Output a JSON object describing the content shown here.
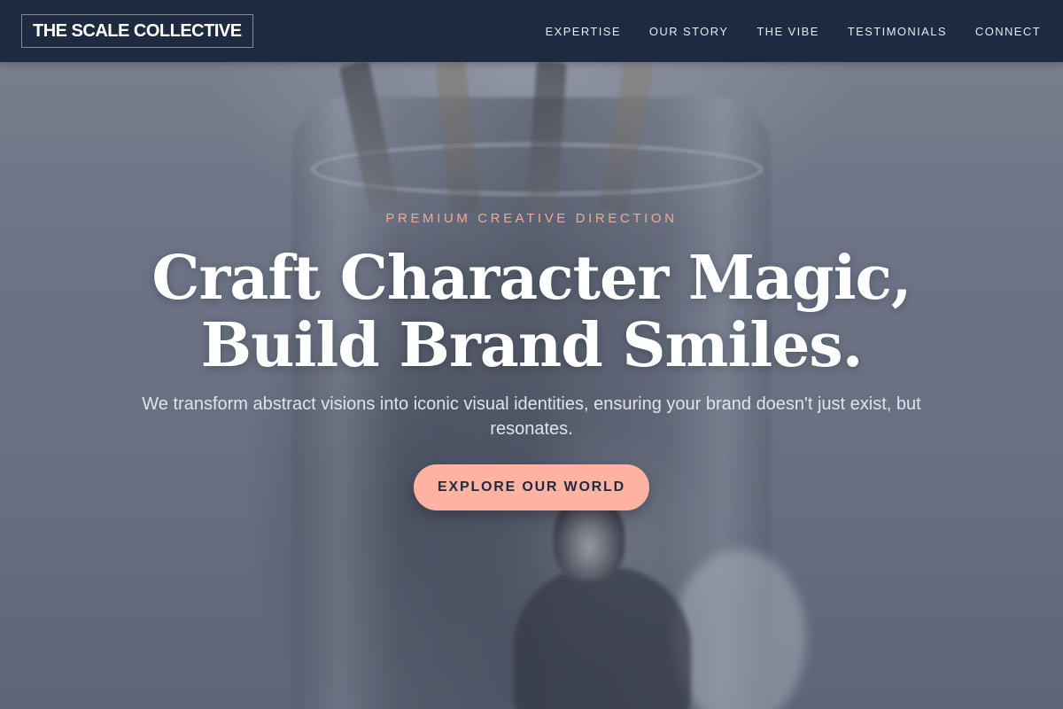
{
  "nav": {
    "logo": "THE SCALE COLLECTIVE",
    "links": [
      "EXPERTISE",
      "OUR STORY",
      "THE VIBE",
      "TESTIMONIALS",
      "CONNECT"
    ]
  },
  "hero": {
    "eyebrow": "PREMIUM CREATIVE DIRECTION",
    "headline_line1": "Craft Character Magic,",
    "headline_line2": "Build Brand Smiles.",
    "subtitle": "We transform abstract visions into iconic visual identities, ensuring your brand doesn't just exist, but resonates.",
    "cta_label": "EXPLORE OUR WORLD"
  },
  "colors": {
    "navbar_bg": "#1e2a3f",
    "accent": "#ffb3a0",
    "eyebrow": "#f0a896",
    "hero_overlay": "#5f687a"
  }
}
